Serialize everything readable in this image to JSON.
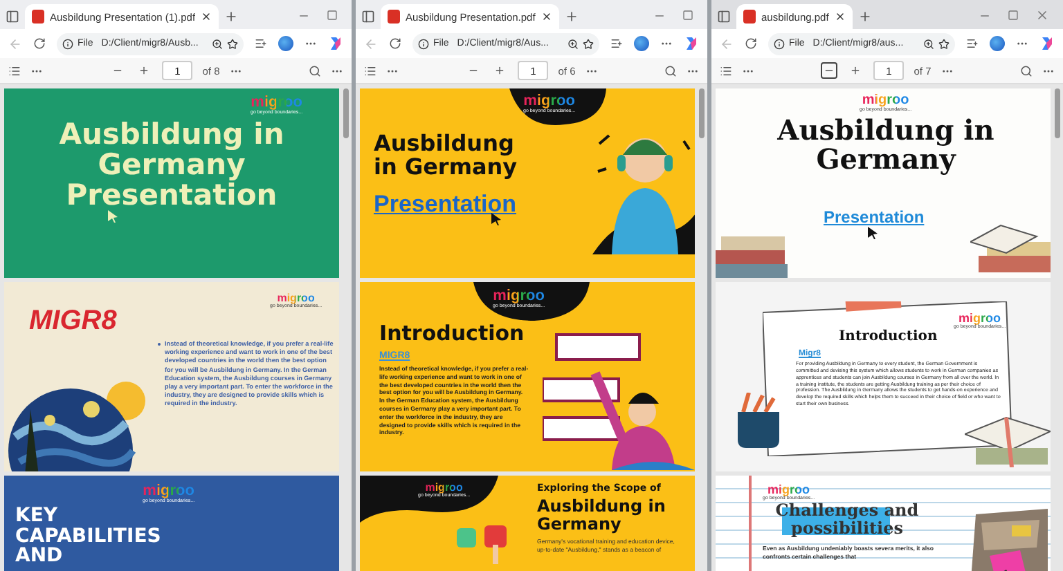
{
  "windows": [
    {
      "active": true,
      "tab": {
        "title": "Ausbildung Presentation (1).pdf",
        "selected": true
      },
      "file_label": "File",
      "address": "D:/Client/migr8/Ausb...",
      "page": "1",
      "page_count": "of 8",
      "zoom_out_focused": false,
      "close_visible": false,
      "slides": [
        {
          "kind": "teal_title",
          "logo": {
            "text": "migroo",
            "tagline": "go beyond boundaries..."
          },
          "title": "Ausbildung in Germany Presentation"
        },
        {
          "kind": "brand_bullet",
          "logo": {
            "text": "migroo",
            "tagline": "go beyond boundaries..."
          },
          "brand": "MIGR8",
          "paragraph": "Instead of theoretical knowledge, if you prefer a real-life working experience and want to work in one of the best developed countries in the world then the best option for you will be Ausbildung in Germany. In the German Education system, the Ausbildung courses in Germany play a very important part. To enter the workforce in the industry, they are designed to provide skills which is required in the industry."
        },
        {
          "kind": "blue_heading",
          "logo": {
            "text": "migroo",
            "tagline": "go beyond boundaries..."
          },
          "title": "KEY CAPABILITIES AND"
        }
      ]
    },
    {
      "active": true,
      "tab": {
        "title": "Ausbildung Presentation.pdf",
        "selected": true
      },
      "file_label": "File",
      "address": "D:/Client/migr8/Aus...",
      "page": "1",
      "page_count": "of 6",
      "zoom_out_focused": false,
      "close_visible": false,
      "slides": [
        {
          "kind": "yellow_title",
          "logo": {
            "text": "migroo",
            "tagline": "go beyond boundaries..."
          },
          "title": "Ausbildung in Germany",
          "link": "Presentation"
        },
        {
          "kind": "yellow_intro",
          "logo": {
            "text": "migroo",
            "tagline": "go beyond boundaries..."
          },
          "title": "Introduction",
          "link": "MIGR8",
          "paragraph": "Instead of theoretical knowledge, if you prefer a real-life working experience and want to work in one of the best developed countries in the world then the best option for you will be Ausbildung in Germany. In the German Education system, the Ausbildung courses in Germany play a very important part. To enter the workforce in the industry, they are designed to provide skills which is required in the industry."
        },
        {
          "kind": "yellow_scope",
          "logo": {
            "text": "migroo",
            "tagline": "go beyond boundaries..."
          },
          "subtitle": "Exploring the Scope of",
          "title": "Ausbildung in Germany",
          "paragraph": "Germany's vocational training and education device, up-to-date \"Ausbildung,\" stands as a beacon of"
        }
      ]
    },
    {
      "active": false,
      "tab": {
        "title": "ausbildung.pdf",
        "selected": true
      },
      "file_label": "File",
      "address": "D:/Client/migr8/aus...",
      "page": "1",
      "page_count": "of 7",
      "zoom_out_focused": true,
      "close_visible": true,
      "slides": [
        {
          "kind": "serif_title",
          "logo": {
            "text": "migroo",
            "tagline": "go beyond boundaries..."
          },
          "title": "Ausbildung in Germany",
          "link": "Presentation"
        },
        {
          "kind": "note_card",
          "logo": {
            "text": "migroo",
            "tagline": "go beyond boundaries..."
          },
          "title": "Introduction",
          "link": "Migr8",
          "paragraph": "For providing Ausbildung in Germany to every student, the German Government is committed and devising this system which allows students to work in German companies as apprentices and students can join Ausbildung courses in Germany from all over the world. In a training institute, the students are getting Ausbildung training as per their choice of profession. The Ausbildung in Germany allows the students to get hands-on experience and develop the required skills which helps them to succeed in their choice of field or who want to start their own business."
        },
        {
          "kind": "notebook_heading",
          "logo": {
            "text": "migroo",
            "tagline": "go beyond boundaries..."
          },
          "title": "Challenges and possibilities",
          "paragraph": "Even as Ausbildung undeniably boasts severa merits, it also confronts certain challenges that"
        }
      ]
    }
  ]
}
